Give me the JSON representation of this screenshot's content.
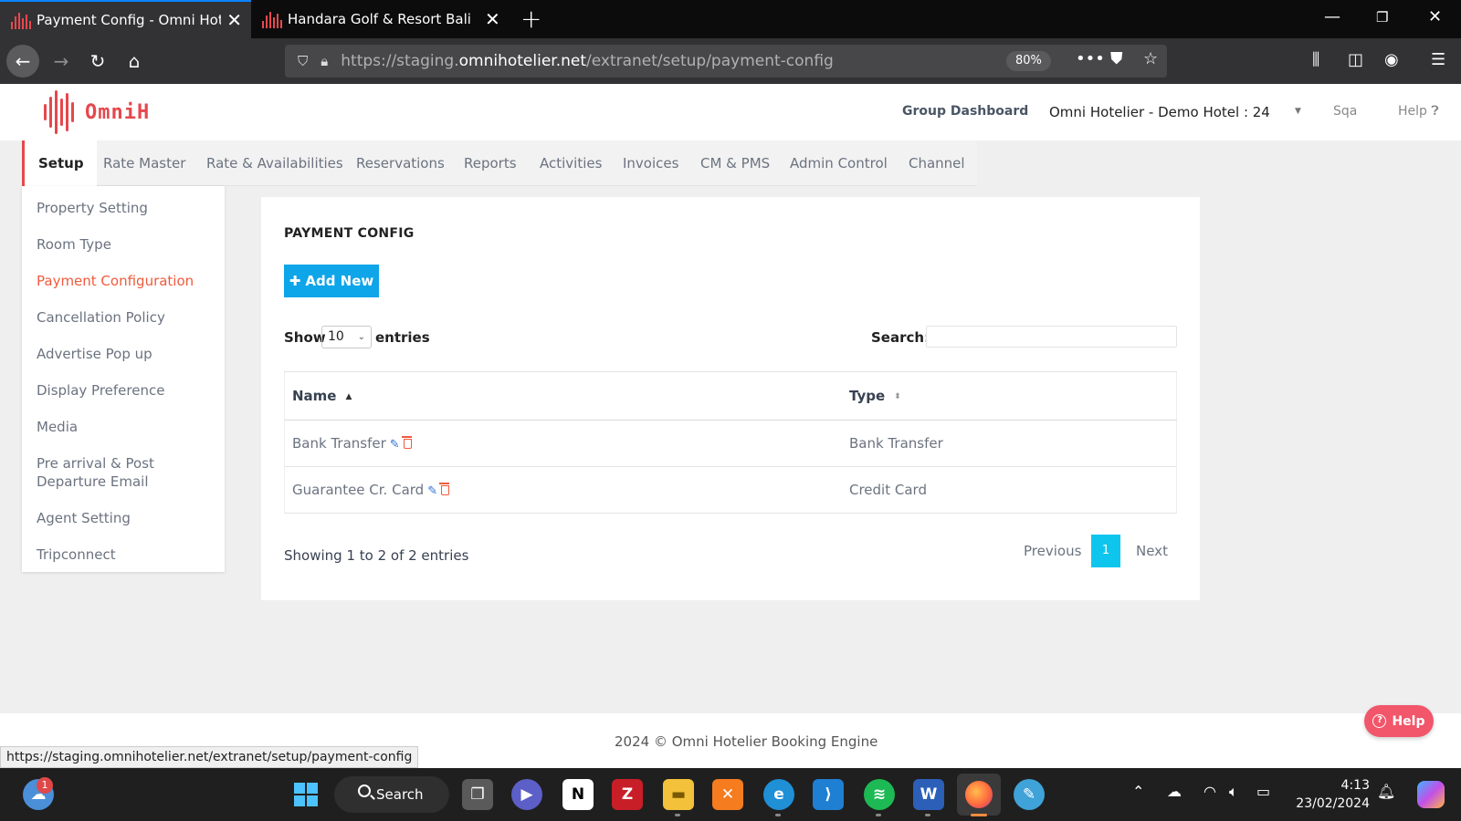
{
  "browser": {
    "tabs": [
      {
        "title": "Payment Config - Omni Hotelier",
        "active": true
      },
      {
        "title": "Handara Golf & Resort Bali",
        "active": false
      }
    ],
    "url_host_prefix": "https://staging.",
    "url_host": "omnihotelier.net",
    "url_path": "/extranet/setup/payment-config",
    "zoom": "80%"
  },
  "header": {
    "logo_text": "OmniH",
    "group_dashboard": "Group Dashboard",
    "hotel_select": "Omni Hotelier - Demo Hotel : 24",
    "user": "Sqa",
    "help": "Help"
  },
  "main_nav": [
    "Setup",
    "Rate Master",
    "Rate & Availabilities",
    "Reservations",
    "Reports",
    "Activities",
    "Invoices",
    "CM & PMS",
    "Admin Control",
    "Channel"
  ],
  "sidebar": [
    {
      "label": "Property Setting",
      "active": false
    },
    {
      "label": "Room Type",
      "active": false
    },
    {
      "label": "Payment Configuration",
      "active": true
    },
    {
      "label": "Cancellation Policy",
      "active": false
    },
    {
      "label": "Advertise Pop up",
      "active": false
    },
    {
      "label": "Display Preference",
      "active": false
    },
    {
      "label": "Media",
      "active": false
    },
    {
      "label": "Pre arrival & Post Departure Email",
      "active": false
    },
    {
      "label": "Agent Setting",
      "active": false
    },
    {
      "label": "Tripconnect",
      "active": false
    }
  ],
  "content": {
    "title": "PAYMENT CONFIG",
    "add_button": "Add New",
    "show_label": "Show",
    "entries_value": "10",
    "entries_label": "entries",
    "search_label": "Search:",
    "search_value": "",
    "columns": [
      "Name",
      "Type"
    ],
    "rows": [
      {
        "name": "Bank Transfer",
        "type": "Bank Transfer"
      },
      {
        "name": "Guarantee Cr. Card",
        "type": "Credit Card"
      }
    ],
    "info": "Showing 1 to 2 of 2 entries",
    "pagination": {
      "previous": "Previous",
      "current": "1",
      "next": "Next"
    }
  },
  "footer": {
    "copyright": "2024 © Omni Hotelier Booking Engine"
  },
  "help_button": "Help",
  "status_url": "https://staging.omnihotelier.net/extranet/setup/payment-config",
  "taskbar": {
    "search_label": "Search",
    "notification_count": "1",
    "time": "4:13",
    "date": "23/02/2024"
  },
  "colors": {
    "accent": "#e5484d",
    "primary": "#0ea5e9",
    "active_sidebar": "#f05a3c",
    "page_current": "#0ec5ee"
  }
}
